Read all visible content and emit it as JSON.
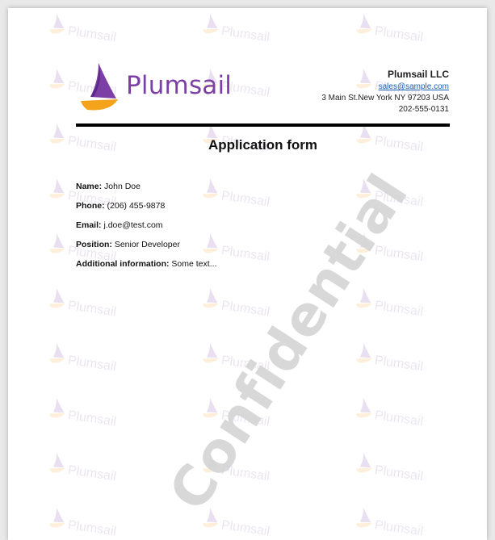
{
  "watermark": {
    "tile_text": "Plumsail",
    "confidential_text": "Confidential"
  },
  "header": {
    "logo_text": "Plumsail",
    "company_name": "Plumsail LLC",
    "email": "sales@sample.com",
    "address": "3 Main St.New York NY 97203 USA",
    "phone": "202-555-0131"
  },
  "form": {
    "title": "Application form",
    "fields": [
      {
        "label": "Name:",
        "value": "John Doe"
      },
      {
        "label": "Phone:",
        "value": "(206) 455-9878"
      },
      {
        "label": "Email:",
        "value": "j.doe@test.com"
      },
      {
        "label": "Position:",
        "value": "Senior Developer"
      },
      {
        "label": "Additional information:",
        "value": "Some text..."
      }
    ]
  },
  "colors": {
    "brand_purple": "#7c3fa6",
    "brand_orange": "#f5a31a",
    "link_blue": "#1a5fb4",
    "watermark_gray": "#d6d6d6"
  },
  "icons": {
    "logo": "plumsail-sail-logo",
    "tile": "plumsail-sail-logo"
  }
}
